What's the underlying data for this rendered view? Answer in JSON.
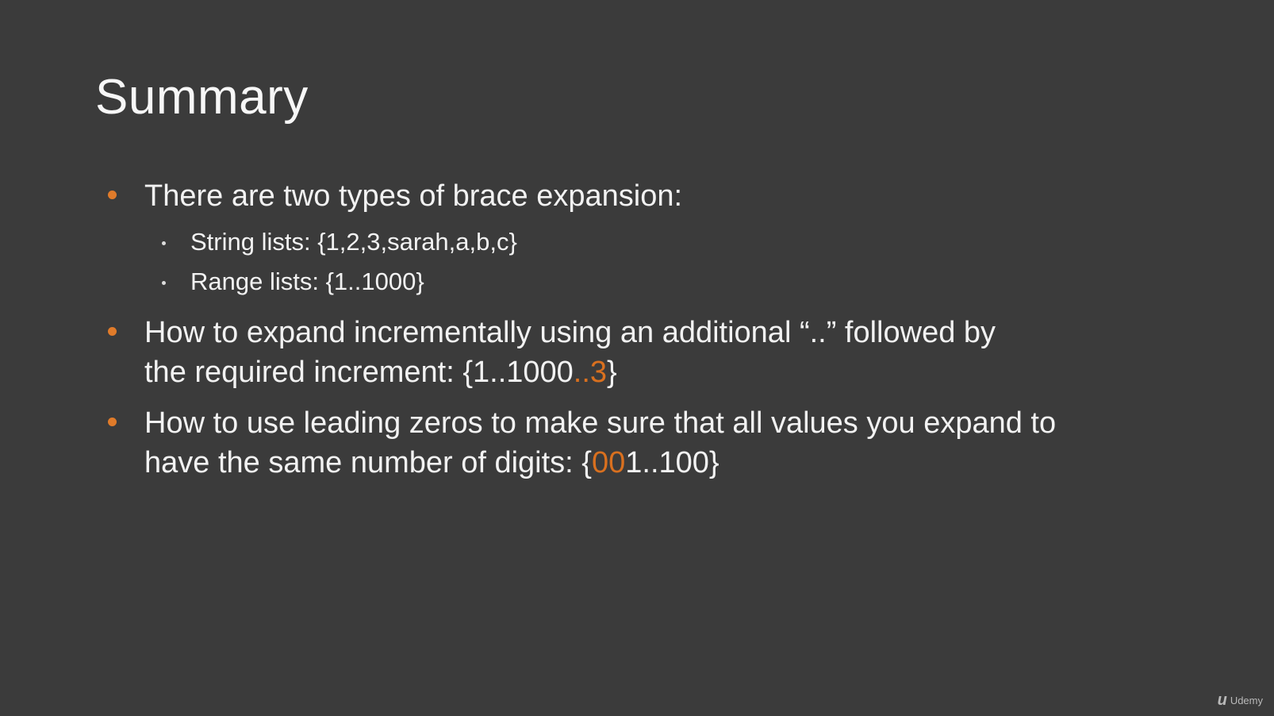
{
  "slide": {
    "title": "Summary",
    "bullets": [
      {
        "text": "There are two types of brace expansion:",
        "sub_items": [
          "String lists: {1,2,3,sarah,a,b,c}",
          "Range lists: {1..1000}"
        ]
      },
      {
        "line1": "How to expand incrementally using an additional “..” followed by",
        "line2_prefix": "the required increment: {1..1000",
        "line2_accent": "..3",
        "line2_suffix": "}"
      },
      {
        "line1": "How to use leading zeros to make sure that all values you expand to",
        "line2_prefix": "have the same number of digits: {",
        "line2_accent": "00",
        "line2_suffix": "1..100}"
      }
    ]
  },
  "branding": {
    "logo_text": "Udemy",
    "logo_icon": "udemy-logo-icon"
  },
  "colors": {
    "background": "#3b3b3b",
    "text": "#f2f2f2",
    "accent": "#d9701f"
  }
}
